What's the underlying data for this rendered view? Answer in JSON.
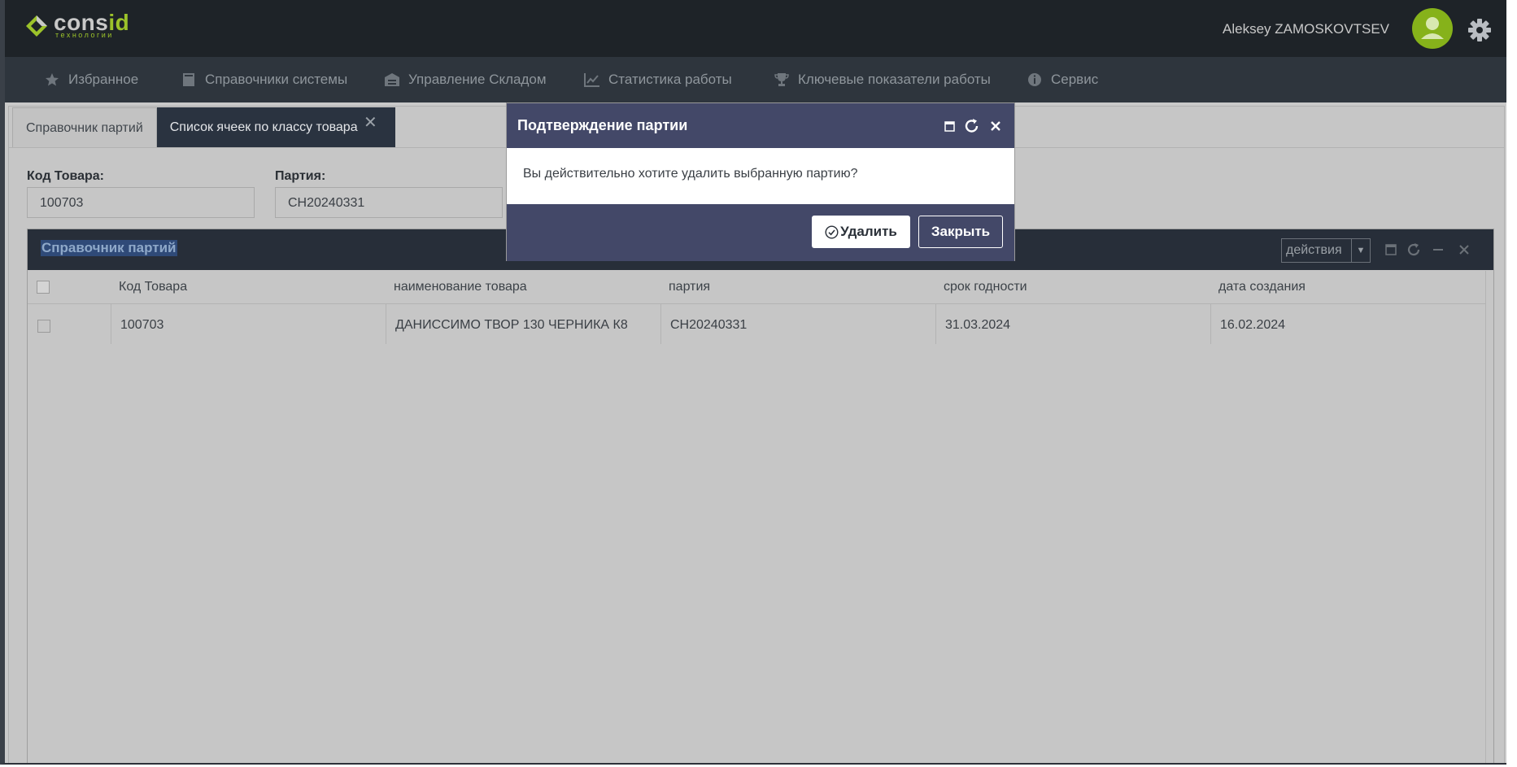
{
  "app": {
    "logo_word_main": "cons",
    "logo_word_accent": "id",
    "logo_sub": "технологии",
    "user_name": "Aleksey ZAMOSKOVTSEV"
  },
  "menu": [
    {
      "label": "Избранное",
      "icon": "star-icon"
    },
    {
      "label": "Справочники системы",
      "icon": "book-icon"
    },
    {
      "label": "Управление Складом",
      "icon": "warehouse-icon"
    },
    {
      "label": "Статистика работы",
      "icon": "chart-icon"
    },
    {
      "label": "Ключевые показатели работы",
      "icon": "trophy-icon"
    },
    {
      "label": "Сервис",
      "icon": "info-icon"
    }
  ],
  "tabs": [
    {
      "label": "Справочник партий",
      "active": false
    },
    {
      "label": "Список ячеек по классу товара",
      "active": true
    }
  ],
  "filters": {
    "product_code_label": "Код Товара:",
    "product_code_value": "100703",
    "batch_label": "Партия:",
    "batch_value": "CH20240331"
  },
  "grid": {
    "title": "Справочник партий",
    "actions_label": "действия",
    "columns": [
      "Код Товара",
      "наименование товара",
      "партия",
      "срок годности",
      "дата создания"
    ],
    "rows": [
      [
        "100703",
        "ДАНИССИМО ТВОР 130 ЧЕРНИКА К8",
        "CH20240331",
        "31.03.2024",
        "16.02.2024"
      ]
    ]
  },
  "dialog": {
    "title": "Подтверждение партии",
    "message": "Вы действительно хотите удалить выбранную партию?",
    "delete_label": "Удалить",
    "close_label": "Закрыть"
  },
  "colors": {
    "topbar": "#1e2328",
    "menubar": "#2e353d",
    "dialog_header": "#434868",
    "accent": "#9cc32a"
  }
}
